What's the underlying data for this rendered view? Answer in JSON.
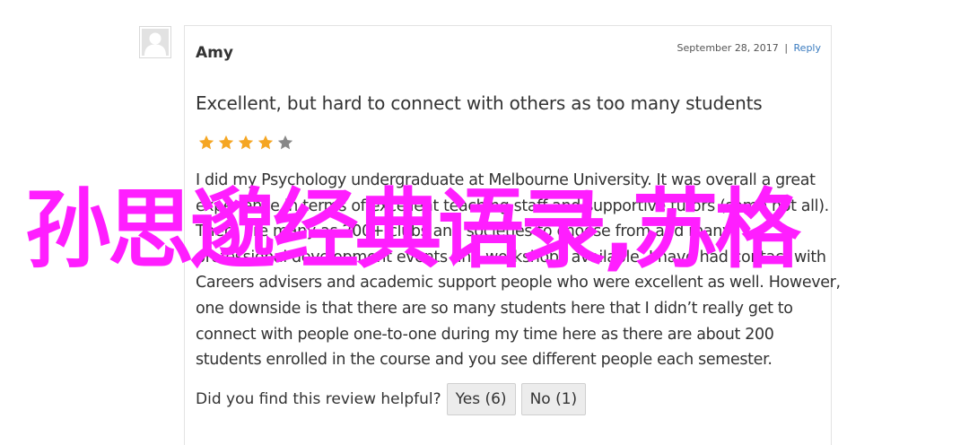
{
  "review": {
    "author": "Amy",
    "date": "September 28, 2017",
    "separator": "|",
    "reply_label": "Reply",
    "title": "Excellent, but hard to connect with others as too many students",
    "rating": 4,
    "rating_max": 5,
    "star_color": "#f5a623",
    "star_empty_color": "#888888",
    "body_lines": [
      "I did my Psychology undergraduate at Melbourne University. It was overall a great",
      "experience in terms of excellent teaching staff and supportive tutors (some not all).",
      "There are many as 200+ clubs and societies to choose from and many",
      "professional development events and workshops available. I have had contact with",
      "Careers advisers and academic support people who were excellent as well. However,",
      "one downside is that there are so many students here that I didn’t really get to",
      "connect with people one-to-one during my time here as there are about 200",
      "students enrolled in the course and you see different people each semester."
    ],
    "helpful_question": "Did you find this review helpful?",
    "yes_label": "Yes (6)",
    "no_label": "No (1)"
  },
  "overlay": {
    "text": "孙思邈经典语录,苏格",
    "color": "#ff1eff"
  },
  "icons": {
    "avatar": "user-silhouette-icon",
    "star": "star-icon"
  }
}
